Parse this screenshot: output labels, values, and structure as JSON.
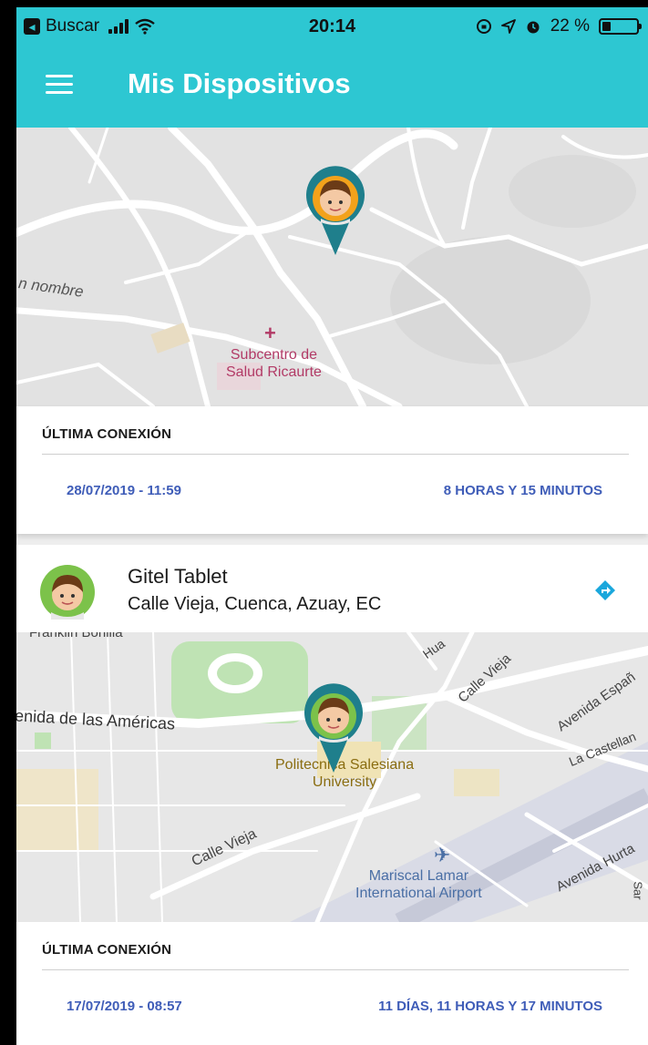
{
  "status_bar": {
    "back_app": "Buscar",
    "time": "20:14",
    "battery": "22 %"
  },
  "app_bar": {
    "title": "Mis Dispositivos"
  },
  "map1": {
    "labels": {
      "road": "n nombre",
      "poi": "Subcentro de\nSalud Ricaurte"
    }
  },
  "device1": {
    "connection_label": "ÚLTIMA CONEXIÓN",
    "last_connection": "28/07/2019 - 11:59",
    "elapsed": "8 HORAS Y 15 MINUTOS"
  },
  "device2": {
    "name": "Gitel Tablet",
    "address": "Calle Vieja, Cuenca, Azuay, EC",
    "connection_label": "ÚLTIMA CONEXIÓN",
    "last_connection": "17/07/2019 - 08:57",
    "elapsed": "11 DÍAS, 11 HORAS Y 17 MINUTOS"
  },
  "map2": {
    "labels": {
      "avenida_americas": "enida de las Américas",
      "calle_vieja_1": "Calle Vieja",
      "calle_vieja_2": "Calle Vieja",
      "avenida_espana": "Avenida Españ",
      "la_castellana": "La Castellan",
      "avenida_hurtado": "Avenida Hurta",
      "huayna": "Hua",
      "franklin": "Franklin Bonilla",
      "university": "Politecnica Salesiana\nUniversity",
      "airport": "Mariscal Lamar\nInternational Airport",
      "sara": "Sar"
    }
  },
  "colors": {
    "accent": "#2dc7d2",
    "link_text": "#3f5db8",
    "pin": "#1f7f8c",
    "pin_ring": "#f3a21b"
  }
}
